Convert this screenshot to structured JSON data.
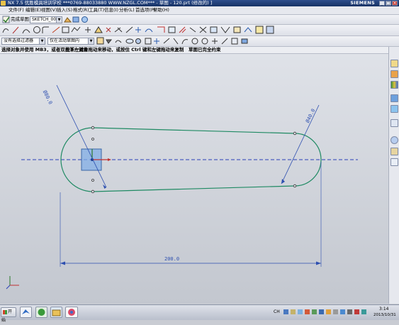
{
  "window": {
    "title": "NX 7.5 优胜模具培训学校   ***0769-88033880  WWW.NZGL.COM***  - 草图 - 120.prt (修改的)  ]",
    "brand": "SIEMENS",
    "controls": [
      "_",
      "□",
      "×"
    ]
  },
  "menu": [
    "文件(F)",
    "编辑(E)",
    "视图(V)",
    "插入(S)",
    "格式(R)",
    "工具(T)",
    "信息(I)",
    "分析(L)",
    "首选项(P)",
    "帮助(H)"
  ],
  "toolbar": {
    "finish_sketch": "完成草图",
    "sketch_name": "SKETCH_000",
    "filter": "没有选择过滤器",
    "scope": "仅在活动草图内"
  },
  "status": {
    "prompt": "选择对象并使用 MB3，或者双击某一对象",
    "hint": "按下左键并拖动来移动，或按住 Ctrl 键和左键拖动来复制",
    "state": "草图已完全约束"
  },
  "sketch": {
    "dim_left": "Ø80.0",
    "dim_right": "Ø40.0",
    "dim_length": "200.0",
    "colors": {
      "curve": "#1f8a63",
      "dimension": "#2d4fb0",
      "centerline": "#2a3fb8",
      "origin": "#5d8fd6"
    }
  },
  "taskbar": {
    "start": "开始",
    "time": "3:14",
    "date": "2013/10/31",
    "ime": "CH"
  }
}
